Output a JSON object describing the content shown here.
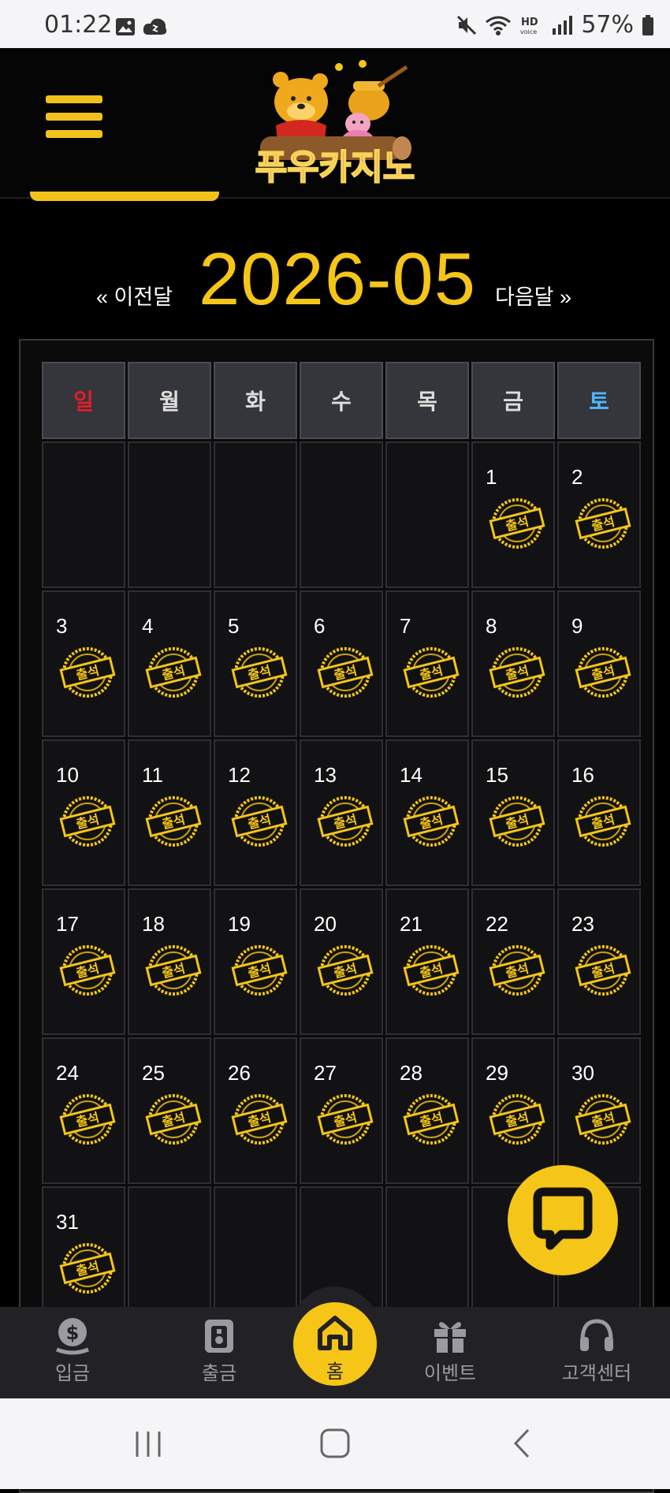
{
  "status_bar": {
    "time": "01:22",
    "battery": "57%",
    "icons": [
      "gallery-icon",
      "cloud-icon",
      "mute-icon",
      "wifi-icon",
      "hd-voice-icon",
      "signal-icon",
      "battery-icon"
    ]
  },
  "header": {
    "logo_text": "푸우카지노"
  },
  "calendar": {
    "month": "2026-05",
    "prev_label": "« 이전달",
    "next_label": "다음달 »",
    "weekdays": [
      "일",
      "월",
      "화",
      "수",
      "목",
      "금",
      "토"
    ],
    "stamp_text": "출석",
    "days": [
      "",
      "",
      "",
      "",
      "",
      "1",
      "2",
      "3",
      "4",
      "5",
      "6",
      "7",
      "8",
      "9",
      "10",
      "11",
      "12",
      "13",
      "14",
      "15",
      "16",
      "17",
      "18",
      "19",
      "20",
      "21",
      "22",
      "23",
      "24",
      "25",
      "26",
      "27",
      "28",
      "29",
      "30",
      "31",
      "",
      "",
      "",
      "",
      "",
      ""
    ],
    "attended_days": [
      "1",
      "2",
      "3",
      "4",
      "5",
      "6",
      "7",
      "8",
      "9",
      "10",
      "11",
      "12",
      "13",
      "14",
      "15",
      "16",
      "17",
      "18",
      "19",
      "20",
      "21",
      "22",
      "23",
      "24",
      "25",
      "26",
      "27",
      "28",
      "29",
      "30",
      "31"
    ]
  },
  "bottom_nav": {
    "deposit": "입금",
    "withdraw": "출금",
    "home": "홈",
    "event": "이벤트",
    "support": "고객센터"
  },
  "colors": {
    "accent": "#f5c518",
    "sunday": "#e11d2a",
    "saturday": "#4fb6ff",
    "background": "#000000"
  }
}
